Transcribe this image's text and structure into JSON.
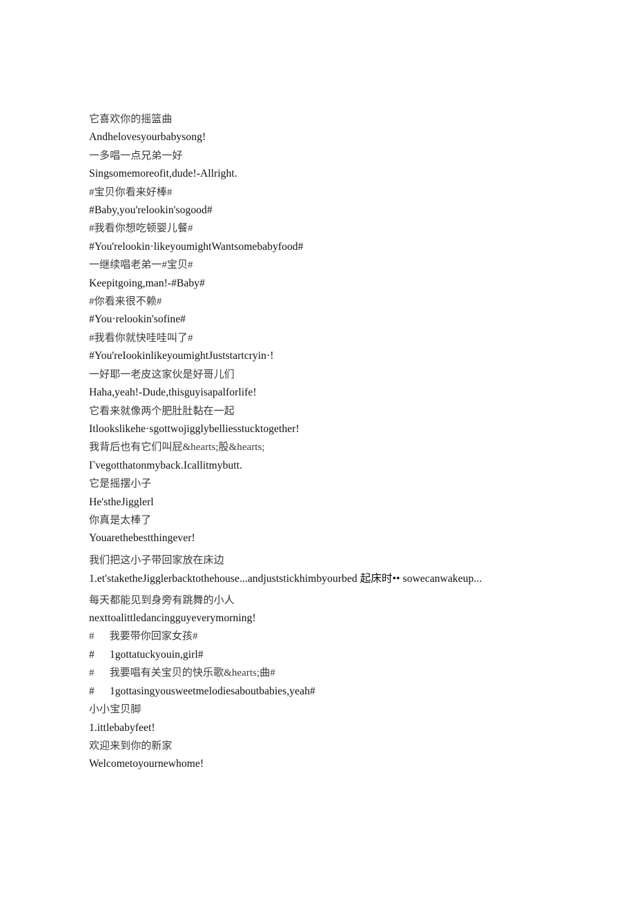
{
  "document": {
    "background_color": "#ffffff",
    "text_color_source": "#3a3a3a",
    "text_color_translation": "#101010",
    "lines": [
      {
        "id": "l1",
        "lang": "zh",
        "text": "它喜欢你的摇篮曲"
      },
      {
        "id": "l2",
        "lang": "en",
        "text": "Andhelovesyourbabysong!"
      },
      {
        "id": "l3",
        "lang": "zh",
        "text": "一多唱一点兄弟一好"
      },
      {
        "id": "l4",
        "lang": "en",
        "text": "Singsomemoreofit,dude!-Allright."
      },
      {
        "id": "l5",
        "lang": "zh",
        "text": "#宝贝你看来好棒#"
      },
      {
        "id": "l6",
        "lang": "en",
        "text": "#Baby,you'relookin'sogood#"
      },
      {
        "id": "l7",
        "lang": "zh",
        "text": "#我看你想吃顿婴儿餐#"
      },
      {
        "id": "l8",
        "lang": "en",
        "text": "#You'relookin·likeyoumightWantsomebabyfood#"
      },
      {
        "id": "l9",
        "lang": "zh",
        "text": "一继续唱老弟一#宝贝#"
      },
      {
        "id": "l10",
        "lang": "en",
        "text": "Keepitgoing,man!-#Baby#"
      },
      {
        "id": "l11",
        "lang": "zh",
        "text": "#你看来很不赖#"
      },
      {
        "id": "l12",
        "lang": "en",
        "text": "#You·relookin'sofine#"
      },
      {
        "id": "l13",
        "lang": "zh",
        "text": "#我看你就快哇哇叫了#"
      },
      {
        "id": "l14",
        "lang": "en",
        "text": "#You'reIookinlikeyoumightJuststartcryin·!"
      },
      {
        "id": "l15",
        "lang": "zh",
        "text": "一好耶一老皮这家伙是好哥儿们"
      },
      {
        "id": "l16",
        "lang": "en",
        "text": "Haha,yeah!-Dude,thisguyisapalforlife!"
      },
      {
        "id": "l17",
        "lang": "zh",
        "text": "它看来就像两个肥肚肚黏在一起"
      },
      {
        "id": "l18",
        "lang": "en",
        "text": "Itlookslikehe·sgottwojigglybelliesstucktogether!"
      },
      {
        "id": "l19",
        "lang": "zh",
        "text": "我背后也有它们叫屁&hearts;股&hearts;"
      },
      {
        "id": "l20",
        "lang": "en",
        "text": "Γvegotthatonmyback.Icallitmybutt."
      },
      {
        "id": "l21",
        "lang": "zh",
        "text": "它是摇摆小子"
      },
      {
        "id": "l22",
        "lang": "en",
        "text": "He'stheJigglerl"
      },
      {
        "id": "l23",
        "lang": "zh",
        "text": "你真是太棒了"
      },
      {
        "id": "l24",
        "lang": "en",
        "text": "Youarethebestthingever!"
      },
      {
        "id": "l25",
        "lang": "zh",
        "text": "我们把这小子带回家放在床边"
      },
      {
        "id": "l26",
        "lang": "en",
        "text": "1.et'staketheJigglerbacktothehouse...andjuststickhimbyourbed 起床时•• sowecanwakeup..."
      },
      {
        "id": "l27",
        "lang": "zh",
        "text": "每天都能见到身旁有跳舞的小人"
      },
      {
        "id": "l28",
        "lang": "en",
        "text": "nexttoalittledancingguyeverymorning!"
      },
      {
        "id": "l29",
        "lang": "zh",
        "text": "我要带你回家女孩#",
        "hash_prefix": "#"
      },
      {
        "id": "l30",
        "lang": "en",
        "text": "1gottatuckyouin,girl#",
        "hash_prefix": "#"
      },
      {
        "id": "l31",
        "lang": "zh",
        "text": "我要唱有关宝贝的快乐歌&hearts;曲#",
        "hash_prefix": "#"
      },
      {
        "id": "l32",
        "lang": "en",
        "text": "1gottasingyousweetmelodiesaboutbabies,yeah#",
        "hash_prefix": "#"
      },
      {
        "id": "l33",
        "lang": "zh",
        "text": "小小宝贝脚"
      },
      {
        "id": "l34",
        "lang": "en",
        "text": "1.ittlebabyfeet!"
      },
      {
        "id": "l35",
        "lang": "zh",
        "text": "欢迎来到你的新家"
      },
      {
        "id": "l36",
        "lang": "en",
        "text": "Welcometoyournewhome!"
      }
    ]
  }
}
